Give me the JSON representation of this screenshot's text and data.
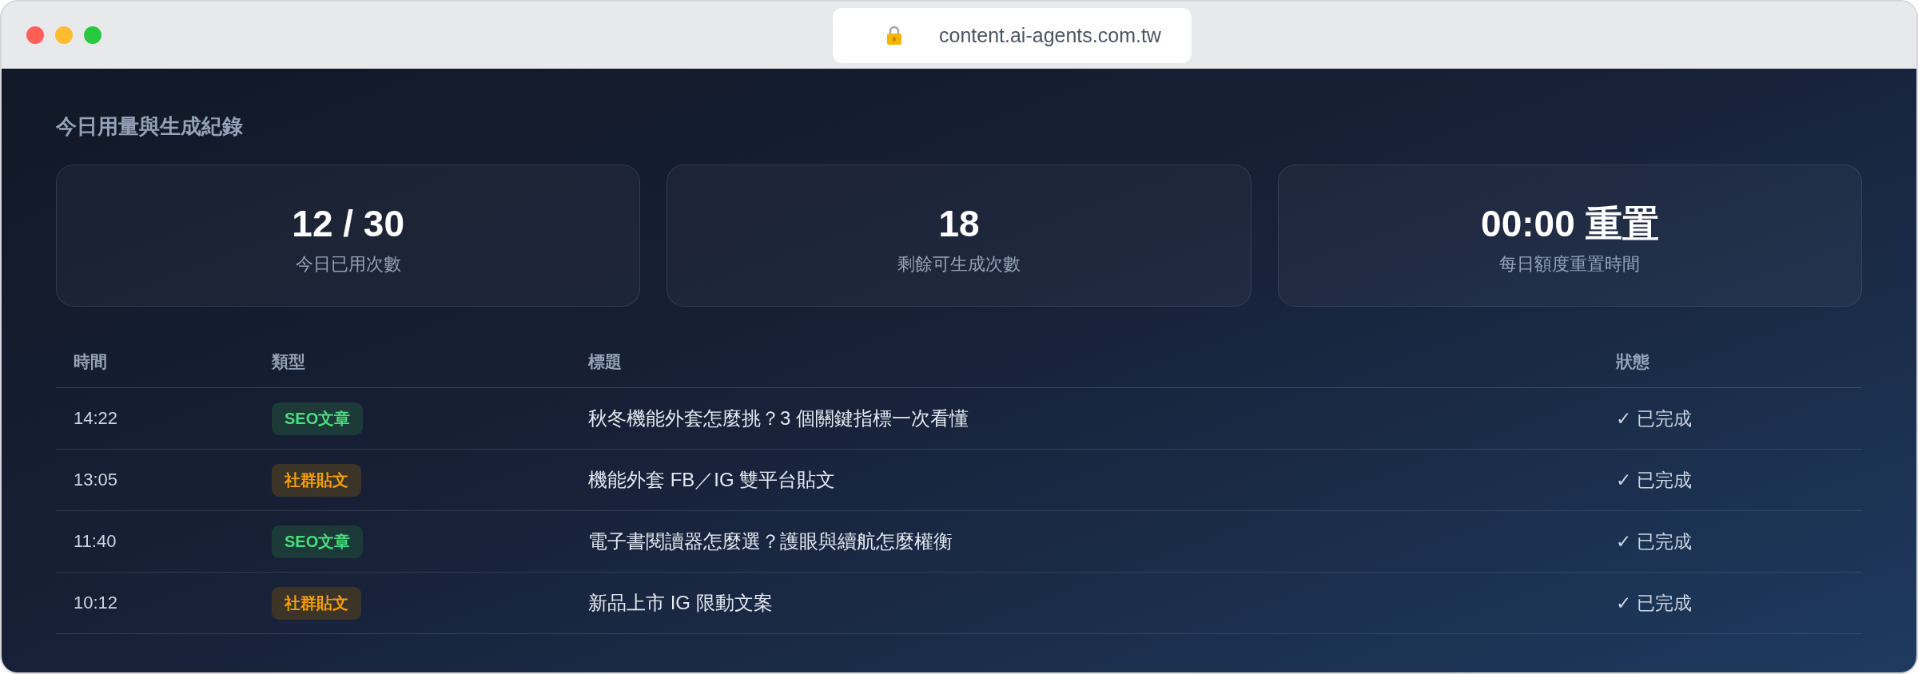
{
  "browser": {
    "url": "content.ai-agents.com.tw"
  },
  "section_title": "今日用量與生成紀錄",
  "stats": [
    {
      "value": "12 / 30",
      "label": "今日已用次數"
    },
    {
      "value": "18",
      "label": "剩餘可生成次數"
    },
    {
      "value": "00:00 重置",
      "label": "每日額度重置時間"
    }
  ],
  "table": {
    "columns": [
      "時間",
      "類型",
      "標題",
      "狀態"
    ],
    "rows": [
      {
        "time": "14:22",
        "type": {
          "label": "SEO文章",
          "kind": "seo"
        },
        "title": "秋冬機能外套怎麼挑？3 個關鍵指標一次看懂",
        "status": "✓ 已完成"
      },
      {
        "time": "13:05",
        "type": {
          "label": "社群貼文",
          "kind": "social"
        },
        "title": "機能外套 FB／IG 雙平台貼文",
        "status": "✓ 已完成"
      },
      {
        "time": "11:40",
        "type": {
          "label": "SEO文章",
          "kind": "seo"
        },
        "title": "電子書閱讀器怎麼選？護眼與續航怎麼權衡",
        "status": "✓ 已完成"
      },
      {
        "time": "10:12",
        "type": {
          "label": "社群貼文",
          "kind": "social"
        },
        "title": "新品上市 IG 限動文案",
        "status": "✓ 已完成"
      }
    ]
  }
}
